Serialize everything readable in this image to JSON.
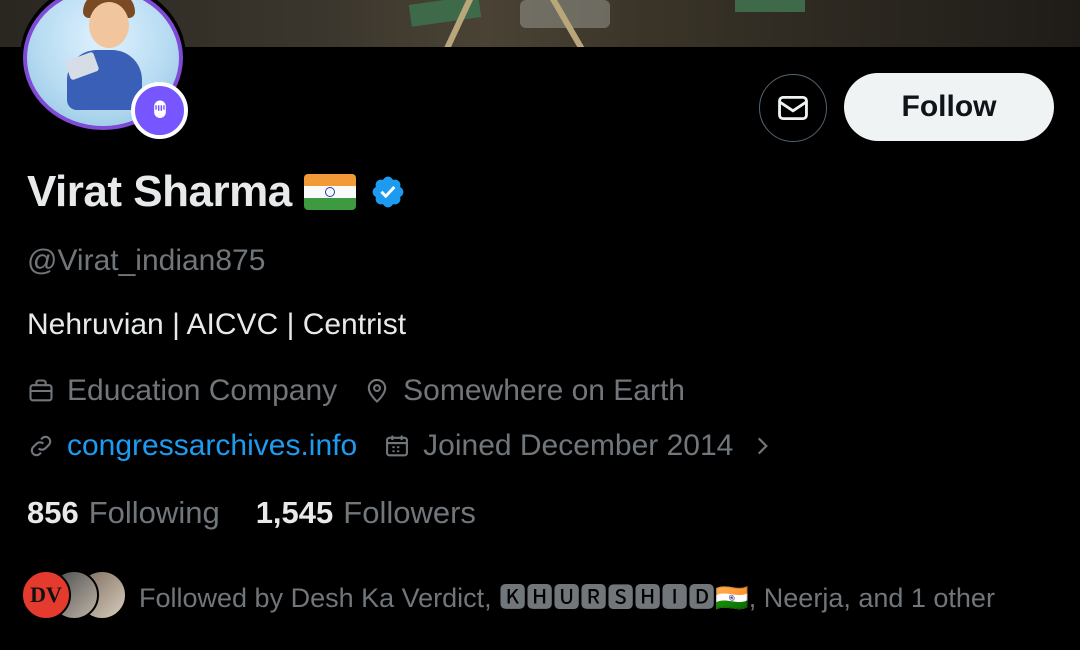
{
  "profile": {
    "name": "Virat Sharma",
    "handle": "@Virat_indian875",
    "bio": "Nehruvian | AICVC | Centrist",
    "category": "Education Company",
    "location": "Somewhere on Earth",
    "website": "congressarchives.info",
    "joined": "Joined December 2014",
    "verified": true
  },
  "actions": {
    "follow_label": "Follow",
    "message_icon": "mail-icon"
  },
  "stats": {
    "following_count": "856",
    "following_label": "Following",
    "followers_count": "1,545",
    "followers_label": "Followers"
  },
  "followed_by": {
    "text": "Followed by Desh Ka Verdict, 🅺🅷🆄🆁🆂🅷🅸🅳🇮🇳, Neerja, and 1 other",
    "first_avatar_initials": "DV"
  },
  "colors": {
    "background": "#000000",
    "text_primary": "#e7e9ea",
    "text_secondary": "#71767b",
    "link": "#1d9bf0",
    "verified": "#1d9bf0",
    "avatar_ring": "#7f4ad6",
    "spaces_badge": "#7856ff",
    "follow_button_bg": "#eff3f4"
  }
}
